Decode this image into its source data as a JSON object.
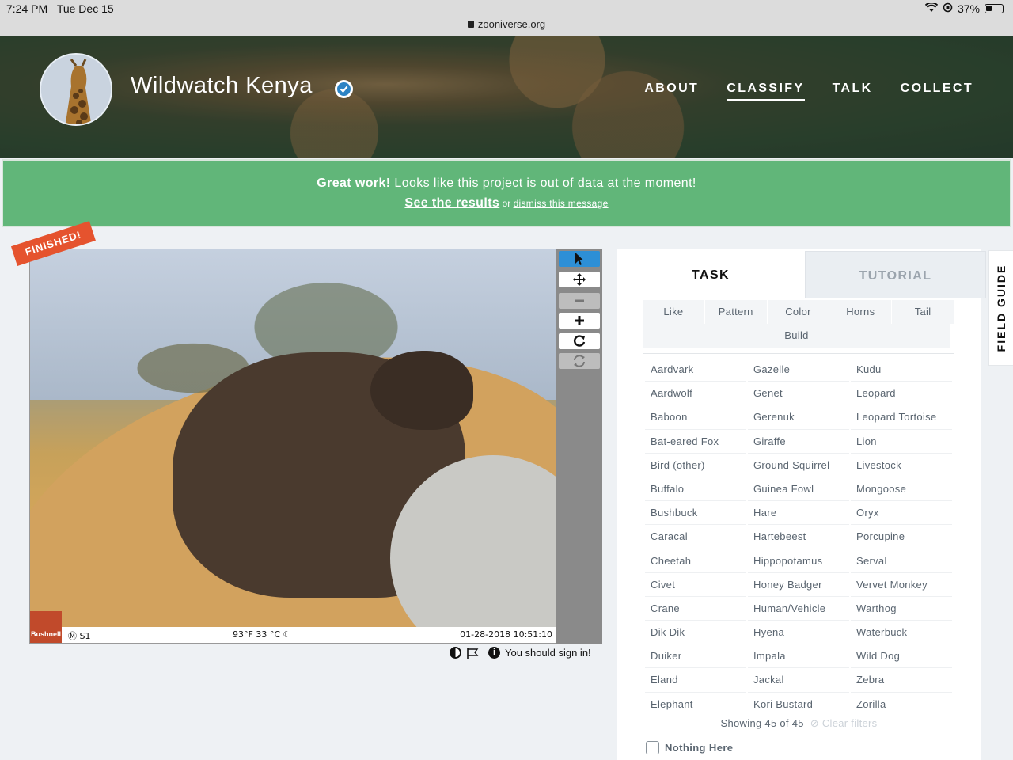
{
  "status_bar": {
    "time": "7:24 PM",
    "date": "Tue Dec 15",
    "url": "zooniverse.org",
    "battery": "37%"
  },
  "header": {
    "title": "Wildwatch Kenya",
    "nav": [
      "ABOUT",
      "CLASSIFY",
      "TALK",
      "COLLECT"
    ],
    "active_nav": "CLASSIFY"
  },
  "banner": {
    "bold": "Great work!",
    "message": " Looks like this project is out of data at the moment!",
    "results_link": "See the results",
    "or": " or ",
    "dismiss_link": "dismiss this message"
  },
  "subject": {
    "badge": "FINISHED!",
    "camera_brand": "Bushnell",
    "strip_s1": "Ⓜ S1",
    "strip_temp": "93°F 33 °C ☾",
    "strip_datetime": "01-28-2018 10:51:10"
  },
  "toolbar": {
    "icons": [
      "pointer-icon",
      "pan-icon",
      "zoom-out-icon",
      "zoom-in-icon",
      "rotate-icon",
      "reset-icon"
    ]
  },
  "sign_in": "You should sign in!",
  "panel": {
    "tabs": [
      "TASK",
      "TUTORIAL"
    ],
    "filters_row1": [
      "Like",
      "Pattern",
      "Color",
      "Horns",
      "Tail"
    ],
    "filters_row2": [
      "Build"
    ],
    "columns": [
      [
        "Aardvark",
        "Aardwolf",
        "Baboon",
        "Bat-eared Fox",
        "Bird (other)",
        "Buffalo",
        "Bushbuck",
        "Caracal",
        "Cheetah",
        "Civet",
        "Crane",
        "Dik Dik",
        "Duiker",
        "Eland",
        "Elephant"
      ],
      [
        "Gazelle",
        "Genet",
        "Gerenuk",
        "Giraffe",
        "Ground Squirrel",
        "Guinea Fowl",
        "Hare",
        "Hartebeest",
        "Hippopotamus",
        "Honey Badger",
        "Human/Vehicle",
        "Hyena",
        "Impala",
        "Jackal",
        "Kori Bustard"
      ],
      [
        "Kudu",
        "Leopard",
        "Leopard Tortoise",
        "Lion",
        "Livestock",
        "Mongoose",
        "Oryx",
        "Porcupine",
        "Serval",
        "Vervet Monkey",
        "Warthog",
        "Waterbuck",
        "Wild Dog",
        "Zebra",
        "Zorilla"
      ]
    ],
    "showing": "Showing 45 of 45",
    "clear_filters": "Clear filters",
    "nothing_here": "Nothing Here"
  },
  "field_guide": "FIELD GUIDE"
}
